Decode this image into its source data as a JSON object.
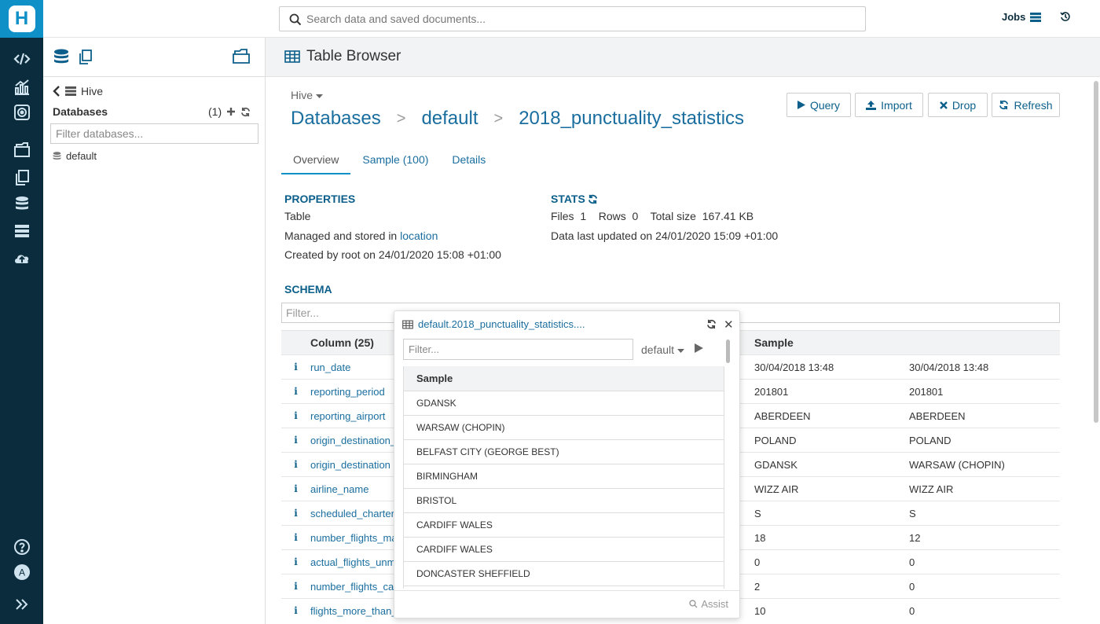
{
  "topbar": {
    "search_placeholder": "Search data and saved documents...",
    "jobs_label": "Jobs"
  },
  "assist": {
    "crumb_label": "Hive",
    "databases_title": "Databases",
    "databases_count": "(1)",
    "filter_placeholder": "Filter databases...",
    "databases": [
      "default"
    ]
  },
  "main": {
    "title": "Table Browser",
    "engine": "Hive",
    "breadcrumb": {
      "root": "Databases",
      "db": "default",
      "table": "2018_punctuality_statistics"
    },
    "buttons": {
      "query": "Query",
      "import": "Import",
      "drop": "Drop",
      "refresh": "Refresh"
    },
    "tabs": [
      "Overview",
      "Sample (100)",
      "Details"
    ],
    "properties": {
      "title": "PROPERTIES",
      "type": "Table",
      "managed_prefix": "Managed and stored in",
      "managed_link": "location",
      "created": "Created by root on 24/01/2020 15:08 +01:00"
    },
    "stats": {
      "title": "STATS",
      "files_label": "Files",
      "files_value": "1",
      "rows_label": "Rows",
      "rows_value": "0",
      "size_label": "Total size",
      "size_value": "167.41 KB",
      "updated": "Data last updated on 24/01/2020 15:09 +01:00"
    },
    "schema": {
      "title": "SCHEMA",
      "filter_placeholder": "Filter...",
      "column_header": "Column (25)",
      "sample_header": "Sample",
      "rows": [
        {
          "info": "i",
          "name": "run_date",
          "s1": "30/04/2018 13:48",
          "s2": "30/04/2018 13:48"
        },
        {
          "info": "i",
          "name": "reporting_period",
          "s1": "201801",
          "s2": "201801"
        },
        {
          "info": "i",
          "name": "reporting_airport",
          "s1": "ABERDEEN",
          "s2": "ABERDEEN"
        },
        {
          "info": "i",
          "name": "origin_destination_",
          "s1": "POLAND",
          "s2": "POLAND"
        },
        {
          "info": "i",
          "name": "origin_destination",
          "s1": "GDANSK",
          "s2": "WARSAW (CHOPIN)"
        },
        {
          "info": "i",
          "name": "airline_name",
          "s1": "WIZZ AIR",
          "s2": "WIZZ AIR"
        },
        {
          "info": "i",
          "name": "scheduled_charter",
          "s1": "S",
          "s2": "S"
        },
        {
          "info": "i",
          "name": "number_flights_ma",
          "s1": "18",
          "s2": "12"
        },
        {
          "info": "i",
          "name": "actual_flights_unm",
          "s1": "0",
          "s2": "0"
        },
        {
          "info": "i",
          "name": "number_flights_car",
          "s1": "2",
          "s2": "0"
        },
        {
          "info": "i",
          "name": "flights_more_than_",
          "s1": "10",
          "s2": "0"
        }
      ]
    }
  },
  "popover": {
    "title": "default.2018_punctuality_statistics....",
    "filter_placeholder": "Filter...",
    "db_select": "default",
    "table_header": "Sample",
    "values": [
      "GDANSK",
      "WARSAW (CHOPIN)",
      "BELFAST CITY (GEORGE BEST)",
      "BIRMINGHAM",
      "BRISTOL",
      "CARDIFF WALES",
      "CARDIFF WALES",
      "DONCASTER SHEFFIELD",
      ""
    ],
    "assist_label": "Assist"
  },
  "colors": {
    "rail": "#0b2c3d",
    "logo": "#0f91c7",
    "link": "#1a6e9f",
    "accent": "#0b5f8a"
  },
  "icons": [
    "hue-logo",
    "editor-icon",
    "dashboard-icon",
    "scheduler-icon",
    "documents-icon",
    "files-icon",
    "tables-icon",
    "jobs-icon",
    "importer-icon",
    "help-icon",
    "avatar",
    "expand-icon"
  ]
}
